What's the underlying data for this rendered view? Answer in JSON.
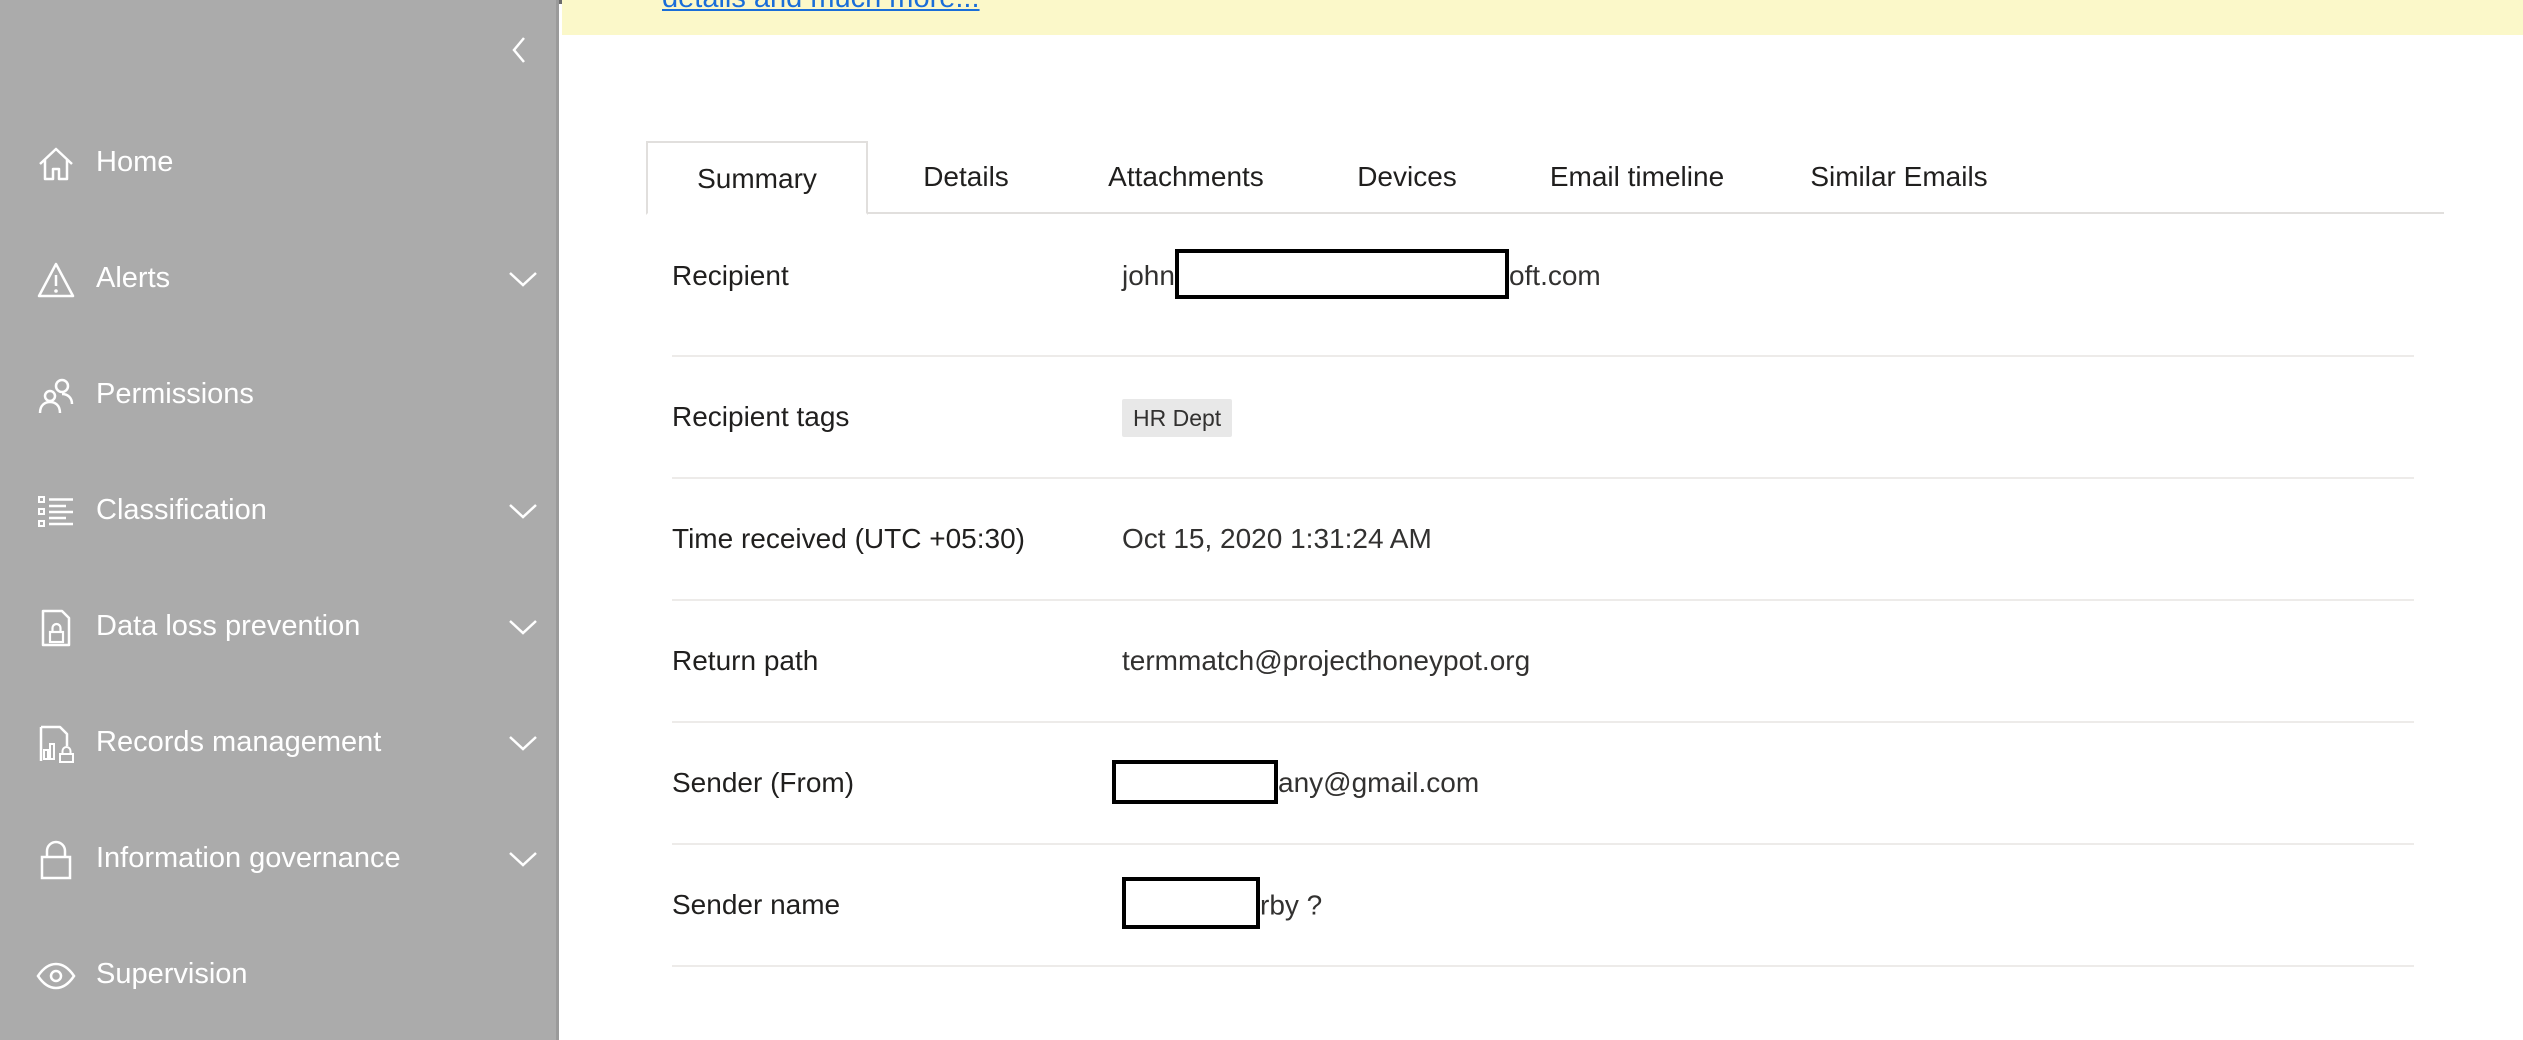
{
  "sidebar": {
    "items": [
      {
        "label": "Home",
        "icon": "home-icon",
        "expandable": false
      },
      {
        "label": "Alerts",
        "icon": "warning-icon",
        "expandable": true
      },
      {
        "label": "Permissions",
        "icon": "people-icon",
        "expandable": false
      },
      {
        "label": "Classification",
        "icon": "list-icon",
        "expandable": true
      },
      {
        "label": "Data loss prevention",
        "icon": "document-lock-icon",
        "expandable": true
      },
      {
        "label": "Records management",
        "icon": "records-icon",
        "expandable": true
      },
      {
        "label": "Information governance",
        "icon": "lock-icon",
        "expandable": true
      },
      {
        "label": "Supervision",
        "icon": "eye-icon",
        "expandable": false
      }
    ]
  },
  "banner": {
    "link_text": "details and much more..."
  },
  "tabs": [
    {
      "label": "Summary",
      "active": true
    },
    {
      "label": "Details",
      "active": false
    },
    {
      "label": "Attachments",
      "active": false
    },
    {
      "label": "Devices",
      "active": false
    },
    {
      "label": "Email timeline",
      "active": false
    },
    {
      "label": "Similar Emails",
      "active": false
    }
  ],
  "details": {
    "recipient": {
      "label": "Recipient",
      "value_prefix": "john",
      "value_suffix": "oft.com"
    },
    "recipient_tags": {
      "label": "Recipient tags",
      "tag": "HR Dept"
    },
    "time_received": {
      "label": "Time received (UTC +05:30)",
      "value": "Oct 15, 2020 1:31:24 AM"
    },
    "return_path": {
      "label": "Return path",
      "value": "termmatch@projecthoneypot.org"
    },
    "sender_from": {
      "label": "Sender (From)",
      "value_suffix": "any@gmail.com"
    },
    "sender_name": {
      "label": "Sender name",
      "value_suffix": "rby ?"
    }
  },
  "colors": {
    "sidebar_bg": "#ababab",
    "banner_bg": "#fbf8c9",
    "link": "#1a6ed8",
    "tag_bg": "#e8e8e8"
  }
}
